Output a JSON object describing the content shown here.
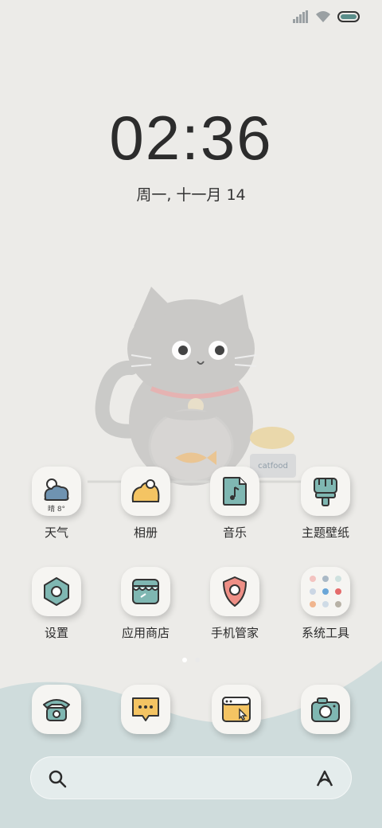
{
  "status_bar": {
    "icons": [
      "signal-icon",
      "wifi-icon",
      "battery-icon"
    ]
  },
  "lockscreen": {
    "time": "02:36",
    "date": "周一, 十一月 14"
  },
  "wallpaper": {
    "cat_food_label": "catfood"
  },
  "apps_row1": [
    {
      "label": "天气",
      "icon": "weather-icon",
      "weather_text": "晴 8°"
    },
    {
      "label": "相册",
      "icon": "gallery-icon"
    },
    {
      "label": "音乐",
      "icon": "music-icon"
    },
    {
      "label": "主题壁纸",
      "icon": "themes-icon"
    }
  ],
  "apps_row2": [
    {
      "label": "设置",
      "icon": "settings-icon"
    },
    {
      "label": "应用商店",
      "icon": "app-store-icon"
    },
    {
      "label": "手机管家",
      "icon": "security-icon"
    },
    {
      "label": "系统工具",
      "icon": "system-tools-folder-icon"
    }
  ],
  "page_indicator": {
    "pages": 2,
    "active": 1
  },
  "dock": [
    {
      "icon": "phone-icon"
    },
    {
      "icon": "messages-icon"
    },
    {
      "icon": "browser-icon"
    },
    {
      "icon": "camera-icon"
    }
  ],
  "search": {
    "icons": [
      "search-icon",
      "assistant-icon"
    ]
  },
  "colors": {
    "background": "#ecebe8",
    "accent_teal": "#7fb7b2",
    "accent_yellow": "#f4c463",
    "accent_salmon": "#ee8f86",
    "wave": "#cfdcdc"
  }
}
